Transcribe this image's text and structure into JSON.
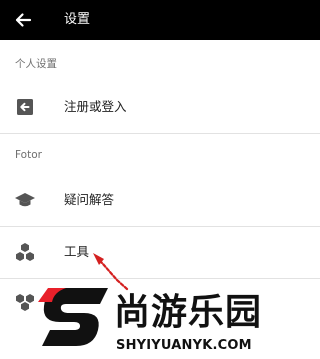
{
  "app_bar": {
    "title": "设置",
    "back_icon": "arrow-left-icon"
  },
  "sections": [
    {
      "header": "个人设置",
      "items": [
        {
          "label": "注册或登入",
          "icon": "login-icon"
        }
      ]
    },
    {
      "header": "Fotor",
      "items": [
        {
          "label": "疑问解答",
          "icon": "graduation-cap-icon"
        },
        {
          "label": "工具",
          "icon": "hexagons-icon"
        },
        {
          "label": "",
          "icon": "hexagons-icon"
        }
      ]
    }
  ],
  "watermark": {
    "text": "尚游乐园",
    "domain": "SHYIYUANYK.COM",
    "accent_color": "#e8202a",
    "text_color": "#111111"
  },
  "colors": {
    "app_bar": "#000000",
    "icon_gray": "#555555",
    "divider": "#e2e2e2",
    "arrow": "#d42020"
  }
}
